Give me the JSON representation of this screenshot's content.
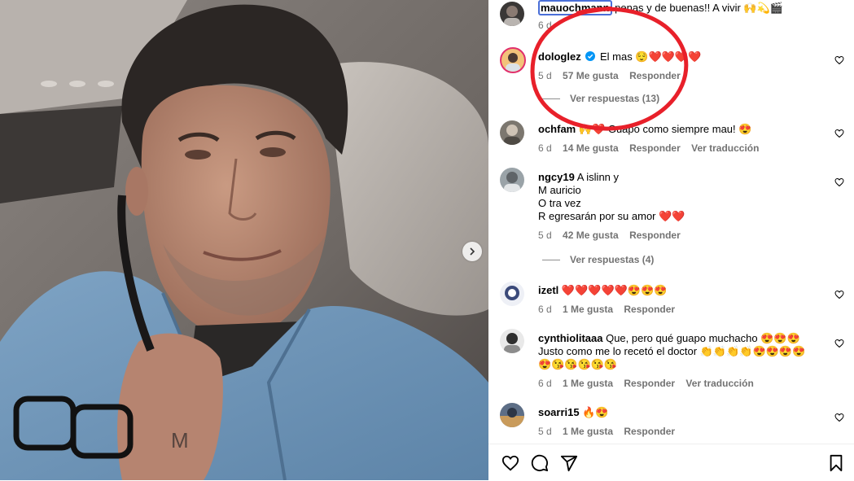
{
  "post": {
    "caption_user": "mauochmann",
    "caption_text": "penas y de buenas!! A vivir 🙌💫🎬",
    "caption_age": "6 d"
  },
  "comments": [
    {
      "user": "dologlez",
      "verified": true,
      "text": "El mas 😌❤️❤️❤️❤️",
      "age": "5 d",
      "likes": "57 Me gusta",
      "reply": "Responder",
      "translate": ""
    },
    {
      "user": "ochfam",
      "verified": false,
      "text": "🙌❤️ Guapo como siempre mau! 😍",
      "age": "6 d",
      "likes": "14 Me gusta",
      "reply": "Responder",
      "translate": "Ver traducción"
    },
    {
      "user": "ngcy19",
      "verified": false,
      "text": "A islinn y\nM auricio\nO tra vez\nR egresarán por su amor ❤️❤️",
      "age": "5 d",
      "likes": "42 Me gusta",
      "reply": "Responder",
      "translate": ""
    },
    {
      "user": "izetl",
      "verified": false,
      "text": "❤️❤️❤️❤️❤️😍😍😍",
      "age": "6 d",
      "likes": "1 Me gusta",
      "reply": "Responder",
      "translate": ""
    },
    {
      "user": "cynthiolitaaa",
      "verified": false,
      "text": "Que, pero qué guapo muchacho 😍😍😍\nJusto como me lo recetó el doctor 👏👏👏👏😍😍😍😍\n😍😘😘😘😘😘",
      "age": "6 d",
      "likes": "1 Me gusta",
      "reply": "Responder",
      "translate": "Ver traducción"
    },
    {
      "user": "soarri15",
      "verified": false,
      "text": "🔥😍",
      "age": "5 d",
      "likes": "1 Me gusta",
      "reply": "Responder",
      "translate": ""
    }
  ],
  "replies": [
    {
      "label": "Ver respuestas (13)"
    },
    {
      "label": "Ver respuestas (4)"
    }
  ],
  "icons": [
    "heart-icon",
    "comment-icon",
    "share-icon",
    "bookmark-icon",
    "chevron-right-icon",
    "verified-icon"
  ],
  "colors": {
    "annotation_red": "#e8202a",
    "meta_gray": "#737373"
  }
}
